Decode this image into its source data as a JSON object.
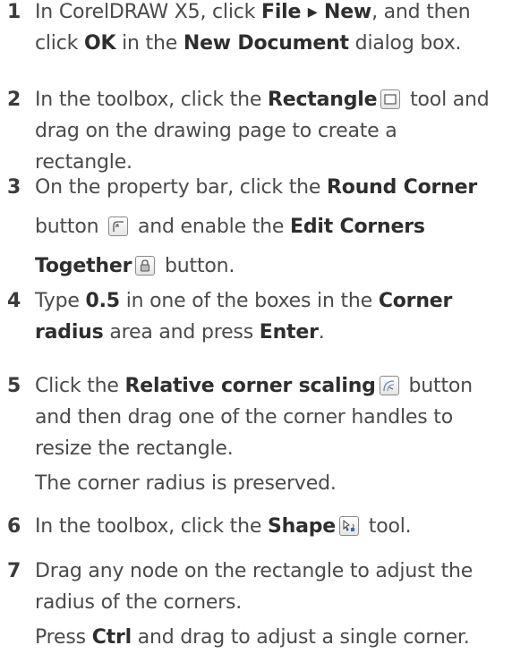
{
  "steps": [
    {
      "num": "1",
      "lines": [
        [
          {
            "t": "In CorelDRAW X5, click "
          },
          {
            "t": "File ▸ New",
            "b": true
          },
          {
            "t": ", and then"
          }
        ],
        [
          {
            "t": "click "
          },
          {
            "t": "OK",
            "b": true
          },
          {
            "t": " in the "
          },
          {
            "t": "New Document",
            "b": true
          },
          {
            "t": " dialog box."
          }
        ]
      ]
    },
    {
      "num": "2",
      "lines": [
        [
          {
            "t": "In the toolbox, click the "
          },
          {
            "t": "Rectangle",
            "b": true
          },
          {
            "icon": "rectangle-tool-icon"
          },
          {
            "t": " tool and"
          }
        ],
        [
          {
            "t": "drag on the drawing page to create a"
          }
        ],
        [
          {
            "t": "rectangle."
          }
        ]
      ]
    },
    {
      "num": "3",
      "lines": [
        [
          {
            "t": "On the property bar, click the "
          },
          {
            "t": "Round Corner",
            "b": true
          }
        ],
        [
          {
            "t": "button "
          },
          {
            "icon": "round-corner-icon"
          },
          {
            "t": " and enable the "
          },
          {
            "t": "Edit Corners",
            "b": true
          }
        ],
        [
          {
            "t": "Together",
            "b": true
          },
          {
            "icon": "lock-icon"
          },
          {
            "t": " button."
          }
        ]
      ]
    },
    {
      "num": "4",
      "lines": [
        [
          {
            "t": "Type "
          },
          {
            "t": "0.5",
            "b": true
          },
          {
            "t": " in one of the boxes in the "
          },
          {
            "t": "Corner",
            "b": true
          }
        ],
        [
          {
            "t": "radius",
            "b": true
          },
          {
            "t": " area and press "
          },
          {
            "t": "Enter",
            "b": true
          },
          {
            "t": "."
          }
        ]
      ]
    },
    {
      "num": "5",
      "lines": [
        [
          {
            "t": "Click the "
          },
          {
            "t": "Relative corner scaling",
            "b": true
          },
          {
            "icon": "relative-corner-scaling-icon"
          },
          {
            "t": " button"
          }
        ],
        [
          {
            "t": "and then drag one of the corner handles to"
          }
        ],
        [
          {
            "t": "resize the rectangle."
          }
        ],
        [
          {
            "t": "The corner radius is preserved."
          }
        ]
      ]
    },
    {
      "num": "6",
      "lines": [
        [
          {
            "t": "In the toolbox, click the "
          },
          {
            "t": "Shape",
            "b": true
          },
          {
            "icon": "shape-tool-icon"
          },
          {
            "t": " tool."
          }
        ]
      ]
    },
    {
      "num": "7",
      "lines": [
        [
          {
            "t": "Drag any node on the rectangle to adjust the"
          }
        ],
        [
          {
            "t": "radius of the corners."
          }
        ],
        [
          {
            "t": "Press "
          },
          {
            "t": "Ctrl",
            "b": true
          },
          {
            "t": " and drag to adjust a single corner."
          }
        ]
      ]
    }
  ]
}
